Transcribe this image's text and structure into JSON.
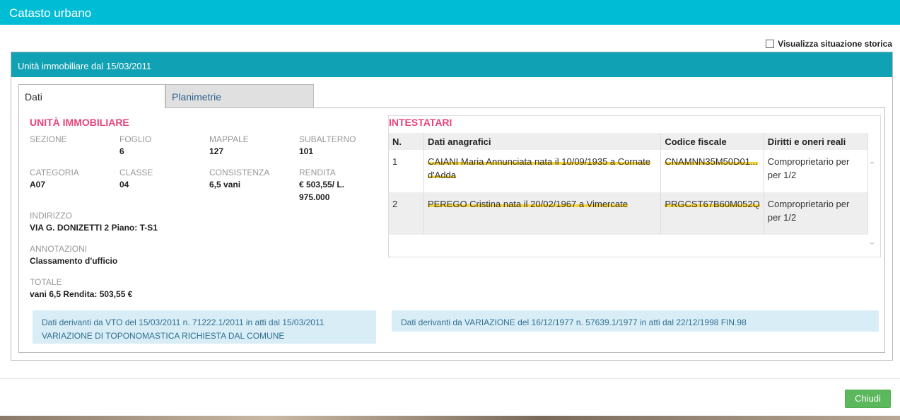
{
  "window": {
    "title": "Catasto urbano"
  },
  "history_toggle": {
    "label": "Visualizza situazione storica",
    "checked": false
  },
  "panel": {
    "title": "Unità immobiliare dal 15/03/2011"
  },
  "tabs": [
    {
      "label": "Dati",
      "active": true
    },
    {
      "label": "Planimetrie",
      "active": false
    }
  ],
  "unit": {
    "title": "UNITÀ IMMOBILIARE",
    "sezione": {
      "label": "SEZIONE",
      "value": ""
    },
    "foglio": {
      "label": "FOGLIO",
      "value": "6"
    },
    "mappale": {
      "label": "MAPPALE",
      "value": "127"
    },
    "subalterno": {
      "label": "SUBALTERNO",
      "value": "101"
    },
    "categoria": {
      "label": "CATEGORIA",
      "value": "A07"
    },
    "classe": {
      "label": "CLASSE",
      "value": "04"
    },
    "consistenza": {
      "label": "CONSISTENZA",
      "value": "6,5 vani"
    },
    "rendita": {
      "label": "RENDITA",
      "value": "€ 503,55/ L. 975.000"
    },
    "indirizzo": {
      "label": "INDIRIZZO",
      "value": "VIA G. DONIZETTI 2 Piano: T-S1"
    },
    "annotazioni": {
      "label": "ANNOTAZIONI",
      "value": "Classamento d'ufficio"
    },
    "totale": {
      "label": "TOTALE",
      "value": "vani 6,5 Rendita: 503,55 €"
    }
  },
  "owners": {
    "title": "INTESTATARI",
    "columns": [
      "N.",
      "Dati anagrafici",
      "Codice fiscale",
      "Diritti e oneri reali"
    ],
    "rows": [
      {
        "n": "1",
        "dati": "CAIANI Maria Annunciata nata il 10/09/1935 a Cornate d'Adda",
        "cf": "CNAMNN35M50D01...",
        "diritti": "Comproprietario per per 1/2"
      },
      {
        "n": "2",
        "dati": "PEREGO Cristina nata il 20/02/1967 a Vimercate",
        "cf": "PRGCST67B60M052Q",
        "diritti": "Comproprietario per per 1/2"
      }
    ]
  },
  "notes": {
    "left": "Dati derivanti da VTO del 15/03/2011 n. 71222.1/2011 in atti dal 15/03/2011 VARIAZIONE DI TOPONOMASTICA RICHIESTA DAL COMUNE",
    "right": "Dati derivanti da VARIAZIONE del 16/12/1977 n. 57639.1/1977 in atti dal 22/12/1998 FIN.98"
  },
  "footer": {
    "close_label": "Chiudi"
  }
}
